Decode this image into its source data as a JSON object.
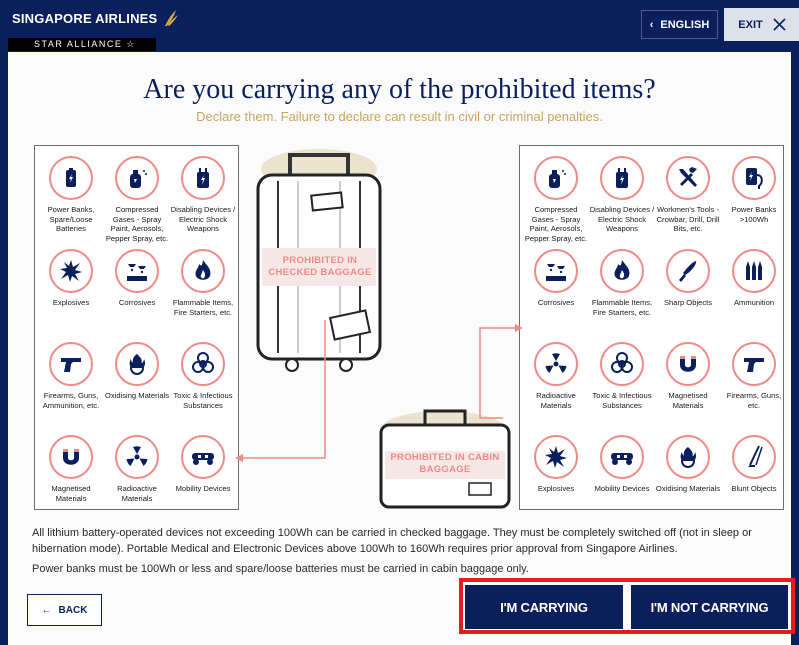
{
  "header": {
    "brand": "SINGAPORE AIRLINES",
    "alliance": "STAR ALLIANCE ☆",
    "language_label": "ENGLISH",
    "exit_label": "EXIT"
  },
  "main": {
    "title": "Are you carrying any of the prohibited items?",
    "subtitle": "Declare them. Failure to declare can result in civil or criminal penalties.",
    "checked_label": "PROHIBITED IN CHECKED BAGGAGE",
    "cabin_label": "PROHIBITED IN CABIN BAGGAGE"
  },
  "checked_items": [
    {
      "label": "Power Banks, Spare/Loose Batteries",
      "icon": "battery-icon"
    },
    {
      "label": "Compressed Gases - Spray Paint, Aerosols, Pepper Spray, etc.",
      "icon": "spray-can-icon"
    },
    {
      "label": "Disabling Devices / Electric Shock Weapons",
      "icon": "shock-weapon-icon"
    },
    {
      "label": "Explosives",
      "icon": "explosion-icon"
    },
    {
      "label": "Corrosives",
      "icon": "corrosive-icon"
    },
    {
      "label": "Flammable Items, Fire Starters, etc.",
      "icon": "flame-icon"
    },
    {
      "label": "Firearms, Guns, Ammunition, etc.",
      "icon": "gun-icon"
    },
    {
      "label": "Oxidising Materials",
      "icon": "oxidiser-icon"
    },
    {
      "label": "Toxic & Infectious Substances",
      "icon": "biohazard-icon"
    },
    {
      "label": "Magnetised Materials",
      "icon": "magnet-icon"
    },
    {
      "label": "Radioactive Materials",
      "icon": "radioactive-icon"
    },
    {
      "label": "Mobility Devices",
      "icon": "hoverboard-icon"
    }
  ],
  "cabin_items": [
    {
      "label": "Compressed Gases - Spray Paint, Aerosols, Pepper Spray, etc.",
      "icon": "spray-can-icon"
    },
    {
      "label": "Disabling Devices / Electric Shock Weapons",
      "icon": "shock-weapon-icon"
    },
    {
      "label": "Workmen's Tools - Crowbar, Drill, Drill Bits, etc.",
      "icon": "tools-icon"
    },
    {
      "label": "Power Banks >100Wh",
      "icon": "power-bank-icon"
    },
    {
      "label": "Corrosives",
      "icon": "corrosive-icon"
    },
    {
      "label": "Flammable Items, Fire Starters, etc.",
      "icon": "flame-icon"
    },
    {
      "label": "Sharp Objects",
      "icon": "knife-icon"
    },
    {
      "label": "Ammunition",
      "icon": "ammunition-icon"
    },
    {
      "label": "Radioactive Materials",
      "icon": "radioactive-icon"
    },
    {
      "label": "Toxic & Infectious Substances",
      "icon": "biohazard-icon"
    },
    {
      "label": "Magnetised Materials",
      "icon": "magnet-icon"
    },
    {
      "label": "Firearms, Guns, etc.",
      "icon": "gun-icon"
    },
    {
      "label": "Explosives",
      "icon": "explosion-icon"
    },
    {
      "label": "Mobility Devices",
      "icon": "hoverboard-icon"
    },
    {
      "label": "Oxidising Materials",
      "icon": "oxidiser-icon"
    },
    {
      "label": "Blunt Objects",
      "icon": "golf-club-icon"
    }
  ],
  "info": {
    "line1": "All lithium battery-operated devices not exceeding 100Wh can be carried in checked baggage. They must be completely switched off (not in sleep or hibernation mode). Portable Medical and Electronic Devices above 100Wh to 160Wh requires prior approval from Singapore Airlines.",
    "line2": "Power banks must be 100Wh or less and spare/loose batteries must be carried in cabin baggage only."
  },
  "footer": {
    "back_label": "BACK",
    "carrying_label": "I'M CARRYING",
    "not_carrying_label": "I'M NOT CARRYING"
  },
  "colors": {
    "navy": "#0b1f5c",
    "gold": "#c9a45e",
    "icon_ring": "#f08a86",
    "highlight": "#e01e1e"
  }
}
